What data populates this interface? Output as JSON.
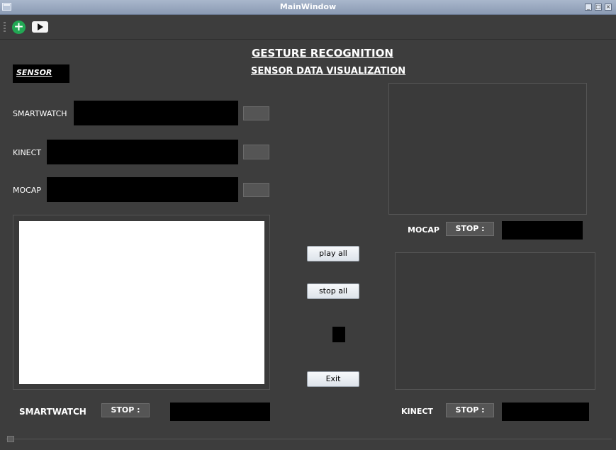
{
  "window": {
    "title": "MainWindow"
  },
  "header": {
    "title": "GESTURE RECOGNITION",
    "subtitle": "SENSOR DATA VISUALIZATION"
  },
  "sensor_box": {
    "label": "SENSOR"
  },
  "sensors": [
    {
      "label": "SMARTWATCH"
    },
    {
      "label": "KINECT"
    },
    {
      "label": "MOCAP"
    }
  ],
  "controls": {
    "play_all": "play all",
    "stop_all": "stop all",
    "exit": "Exit"
  },
  "streams": {
    "mocap": {
      "label": "MOCAP",
      "stop": "STOP :"
    },
    "smartwatch": {
      "label": "SMARTWATCH",
      "stop": "STOP :"
    },
    "kinect": {
      "label": "KINECT",
      "stop": "STOP :"
    }
  },
  "colors": {
    "background": "#3d3d3d",
    "titlebar": "#9aa8c0",
    "add": "#22a854"
  }
}
